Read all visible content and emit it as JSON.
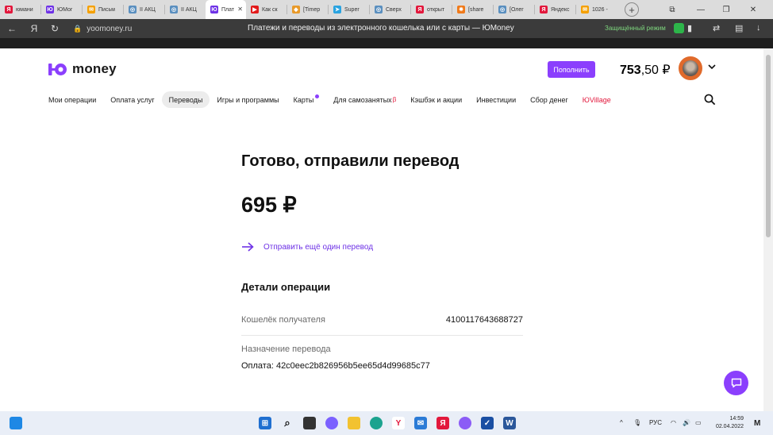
{
  "browser": {
    "tabs": [
      {
        "label": "юмани",
        "color": "#e2183c",
        "glyph": "Я"
      },
      {
        "label": "ЮМоr",
        "color": "#6e32e6",
        "glyph": "Ю"
      },
      {
        "label": "Письм",
        "color": "#f5a000",
        "glyph": "✉"
      },
      {
        "label": "II АКЦ",
        "color": "#5a8fbf",
        "glyph": "◎"
      },
      {
        "label": "II АКЦ",
        "color": "#5a8fbf",
        "glyph": "◎"
      },
      {
        "label": "Плат",
        "color": "#6e32e6",
        "glyph": "Ю"
      },
      {
        "label": "Как ск",
        "color": "#e21b1b",
        "glyph": "▶"
      },
      {
        "label": "[Timep",
        "color": "#e89a2a",
        "glyph": "◆"
      },
      {
        "label": "Super",
        "color": "#2aa3e0",
        "glyph": "➤"
      },
      {
        "label": "Сверх",
        "color": "#5a8fbf",
        "glyph": "◎"
      },
      {
        "label": "открыт",
        "color": "#e2183c",
        "glyph": "Я"
      },
      {
        "label": "[share",
        "color": "#f07a1a",
        "glyph": "✸"
      },
      {
        "label": "[Олег",
        "color": "#5a8fbf",
        "glyph": "◎"
      },
      {
        "label": "Яндекс",
        "color": "#e2183c",
        "glyph": "Я"
      },
      {
        "label": "1026 -",
        "color": "#f5a000",
        "glyph": "✉"
      }
    ],
    "active_tab_index": 5,
    "url": "yoomoney.ru",
    "page_title": "Платежи и переводы из электронного кошелька или с карты — ЮMoney",
    "secure_label": "Защищённый режим"
  },
  "header": {
    "logo_text": "money",
    "topup_label": "Пополнить",
    "balance_int": "753",
    "balance_frac": ",50 ₽"
  },
  "nav": {
    "items": [
      {
        "label": "Мои операции"
      },
      {
        "label": "Оплата услуг"
      },
      {
        "label": "Переводы"
      },
      {
        "label": "Игры и программы"
      },
      {
        "label": "Карты"
      },
      {
        "label": "Для самозанятых",
        "badge": "β"
      },
      {
        "label": "Кэшбэк и акции"
      },
      {
        "label": "Инвестиции"
      },
      {
        "label": "Сбор денег"
      },
      {
        "label": "ЮVillage"
      }
    ]
  },
  "main": {
    "title": "Готово, отправили перевод",
    "amount": "695 ₽",
    "resend_label": "Отправить ещё один перевод",
    "details_title": "Детали операции",
    "wallet_label": "Кошелёк получателя",
    "wallet_value": "4100117643688727",
    "purpose_label": "Назначение перевода",
    "purpose_value": "Оплата: 42c0eec2b826956b5ee65d4d99685c77"
  },
  "taskbar": {
    "lang": "РУС",
    "time": "14:59",
    "date": "02.04.2022"
  },
  "colors": {
    "brand_purple": "#8b3ffd",
    "link_purple": "#6e32e6",
    "accent_red": "#e2183c"
  }
}
